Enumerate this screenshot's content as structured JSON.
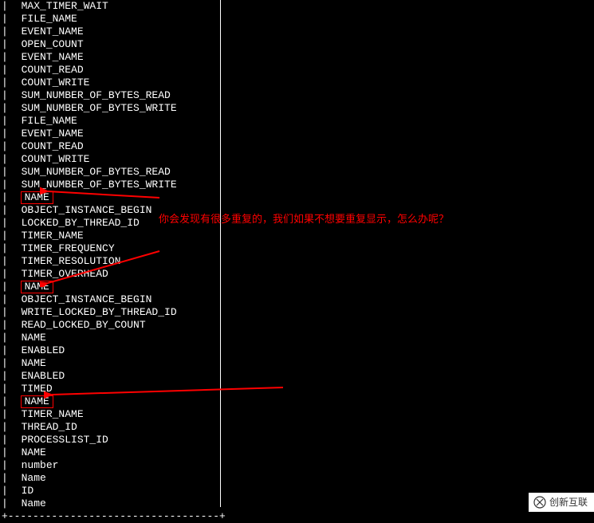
{
  "terminal": {
    "lines": [
      {
        "text": "MAX_TIMER_WAIT",
        "boxed": false
      },
      {
        "text": "FILE_NAME",
        "boxed": false
      },
      {
        "text": "EVENT_NAME",
        "boxed": false
      },
      {
        "text": "OPEN_COUNT",
        "boxed": false
      },
      {
        "text": "EVENT_NAME",
        "boxed": false
      },
      {
        "text": "COUNT_READ",
        "boxed": false
      },
      {
        "text": "COUNT_WRITE",
        "boxed": false
      },
      {
        "text": "SUM_NUMBER_OF_BYTES_READ",
        "boxed": false
      },
      {
        "text": "SUM_NUMBER_OF_BYTES_WRITE",
        "boxed": false
      },
      {
        "text": "FILE_NAME",
        "boxed": false
      },
      {
        "text": "EVENT_NAME",
        "boxed": false
      },
      {
        "text": "COUNT_READ",
        "boxed": false
      },
      {
        "text": "COUNT_WRITE",
        "boxed": false
      },
      {
        "text": "SUM_NUMBER_OF_BYTES_READ",
        "boxed": false
      },
      {
        "text": "SUM_NUMBER_OF_BYTES_WRITE",
        "boxed": false
      },
      {
        "text": "NAME",
        "boxed": true
      },
      {
        "text": "OBJECT_INSTANCE_BEGIN",
        "boxed": false
      },
      {
        "text": "LOCKED_BY_THREAD_ID",
        "boxed": false
      },
      {
        "text": "TIMER_NAME",
        "boxed": false
      },
      {
        "text": "TIMER_FREQUENCY",
        "boxed": false
      },
      {
        "text": "TIMER_RESOLUTION",
        "boxed": false
      },
      {
        "text": "TIMER_OVERHEAD",
        "boxed": false
      },
      {
        "text": "NAME",
        "boxed": true
      },
      {
        "text": "OBJECT_INSTANCE_BEGIN",
        "boxed": false
      },
      {
        "text": "WRITE_LOCKED_BY_THREAD_ID",
        "boxed": false
      },
      {
        "text": "READ_LOCKED_BY_COUNT",
        "boxed": false
      },
      {
        "text": "NAME",
        "boxed": false
      },
      {
        "text": "ENABLED",
        "boxed": false
      },
      {
        "text": "NAME",
        "boxed": false
      },
      {
        "text": "ENABLED",
        "boxed": false
      },
      {
        "text": "TIMED",
        "boxed": false
      },
      {
        "text": "NAME",
        "boxed": true
      },
      {
        "text": "TIMER_NAME",
        "boxed": false
      },
      {
        "text": "THREAD_ID",
        "boxed": false
      },
      {
        "text": "PROCESSLIST_ID",
        "boxed": false
      },
      {
        "text": "NAME",
        "boxed": false
      },
      {
        "text": "number",
        "boxed": false
      },
      {
        "text": "Name",
        "boxed": false
      },
      {
        "text": "ID",
        "boxed": false
      },
      {
        "text": "Name",
        "boxed": false
      }
    ],
    "bottom_border": "+----------------------------------+"
  },
  "annotation": {
    "text": "你会发现有很多重复的，我们如果不想要重复显示，怎么办呢？"
  },
  "watermark": {
    "text": "创新互联"
  },
  "colors": {
    "highlight": "#ff0000",
    "text": "#ffffff",
    "bg": "#000000"
  }
}
